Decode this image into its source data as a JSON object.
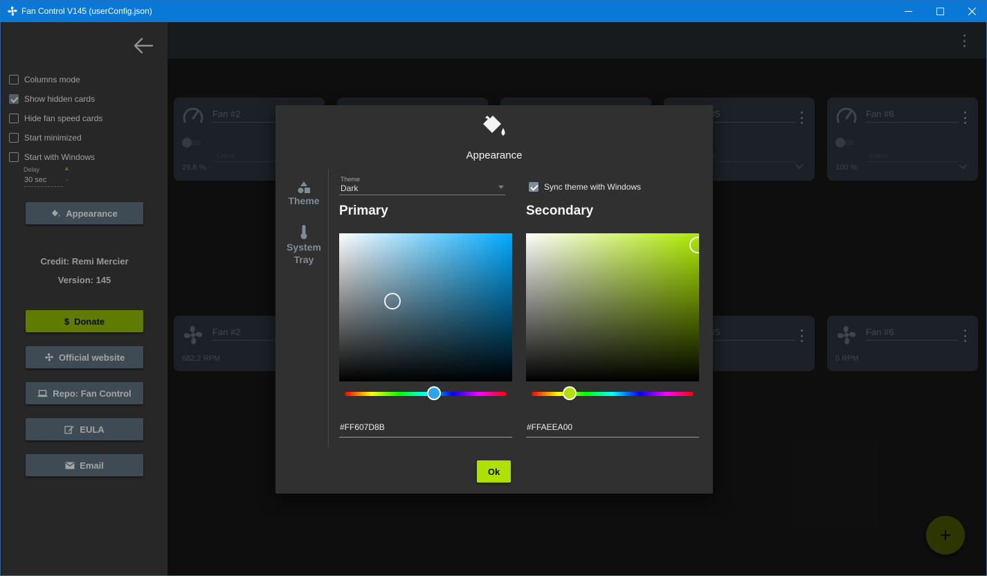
{
  "window": {
    "title": "Fan Control V145 (userConfig.json)"
  },
  "sidebar": {
    "options": [
      {
        "label": "Columns mode",
        "checked": false
      },
      {
        "label": "Show hidden cards",
        "checked": true
      },
      {
        "label": "Hide fan speed cards",
        "checked": false
      },
      {
        "label": "Start minimized",
        "checked": false
      },
      {
        "label": "Start with Windows",
        "checked": false
      }
    ],
    "delay_label": "Delay",
    "delay_value": "30 sec",
    "appearance_label": "Appearance",
    "credit": "Credit: Remi Mercier",
    "version": "Version: 145",
    "donate_label": "Donate",
    "website_label": "Official website",
    "repo_label": "Repo: Fan Control",
    "eula_label": "EULA",
    "email_label": "Email"
  },
  "cards": {
    "control": [
      {
        "name": "Fan #2",
        "field": "Curve",
        "value": "29,8 %"
      },
      {
        "name": "Fan #6",
        "field": "Curve",
        "value": "100 %"
      }
    ],
    "control_partial": {
      "name": "n #5",
      "field": "rve"
    },
    "speed": [
      {
        "name": "Fan #2",
        "value": "682,2 RPM"
      },
      {
        "name": "Fan #6",
        "value": "0 RPM"
      }
    ],
    "speed_partial": {
      "name": "n #5"
    }
  },
  "dialog": {
    "title": "Appearance",
    "nav_theme": "Theme",
    "nav_tray_line1": "System",
    "nav_tray_line2": "Tray",
    "theme_label": "Theme",
    "theme_value": "Dark",
    "sync_label": "Sync theme with Windows",
    "sync_checked": true,
    "primary": {
      "title": "Primary",
      "hex": "#FF607D8B",
      "hue_color": "#00aaff",
      "thumb_color": "#2aa6e8"
    },
    "secondary": {
      "title": "Secondary",
      "hex": "#FFAEEA00",
      "hue_color": "#aeea00",
      "thumb_color": "#aee000"
    },
    "ok_label": "Ok"
  },
  "colors": {
    "accent": "#aeea00",
    "primary": "#607D8B",
    "titlebar": "#0a78d7"
  },
  "icons": [
    "fan-icon",
    "minimize-icon",
    "maximize-icon",
    "close-icon",
    "back-arrow-icon",
    "paint-bucket-icon",
    "shapes-icon",
    "thermometer-icon",
    "gauge-icon",
    "chevron-down-icon",
    "more-vert-icon",
    "dollar-icon",
    "laptop-icon",
    "edit-icon",
    "mail-icon",
    "plus-icon"
  ]
}
